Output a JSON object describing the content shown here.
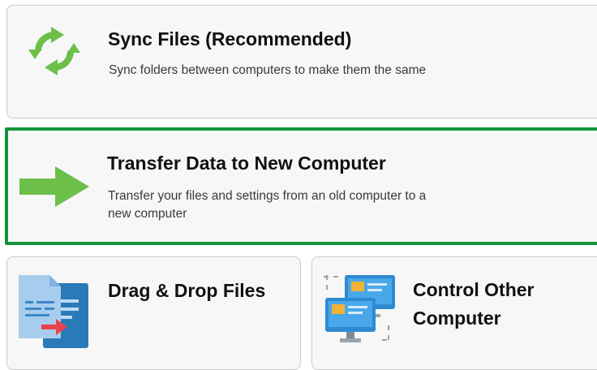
{
  "options": {
    "sync": {
      "title": "Sync Files (Recommended)",
      "description": "Sync folders between computers to make them the same",
      "icon": "sync-arrows-icon",
      "icon_color": "#6cc04a"
    },
    "transfer": {
      "title": "Transfer Data to New Computer",
      "description_line1": "Transfer your files and settings from an old computer to a",
      "description_line2": "new computer",
      "icon": "right-arrow-icon",
      "icon_color": "#6cc04a",
      "selected": true,
      "selected_border_color": "#11953a"
    },
    "drag_drop": {
      "title": "Drag & Drop Files",
      "icon": "document-transfer-icon"
    },
    "control": {
      "title_line1": "Control Other",
      "title_line2": "Computer",
      "icon": "remote-monitors-icon"
    }
  }
}
